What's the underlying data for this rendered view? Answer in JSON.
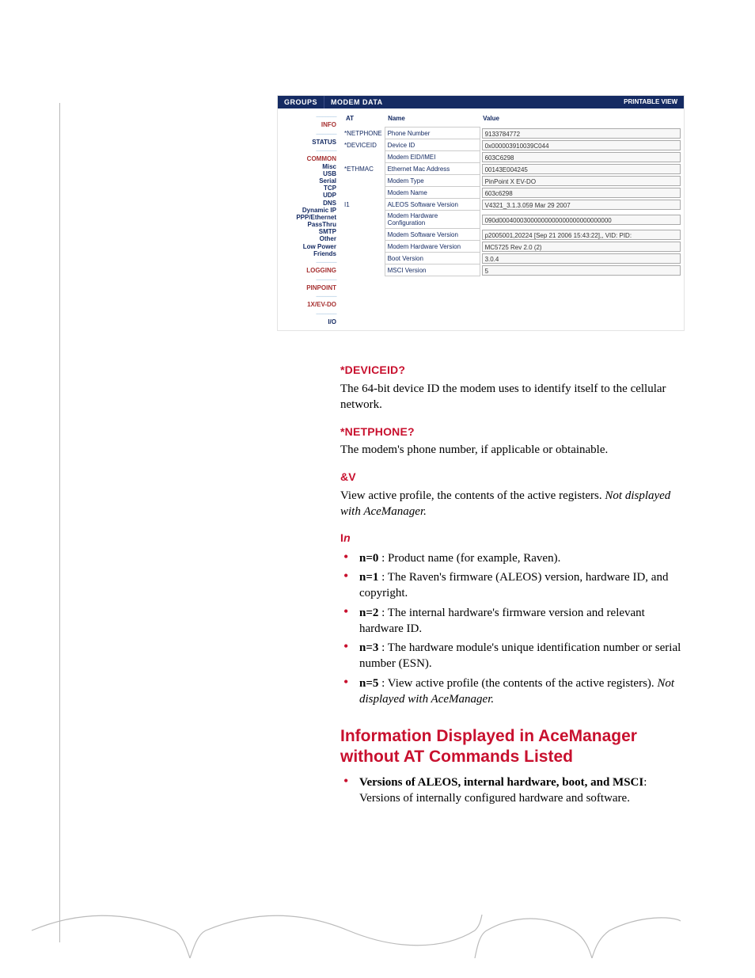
{
  "acemgr": {
    "header": {
      "groups": "GROUPS",
      "modem_data": "MODEM DATA",
      "printable": "PRINTABLE VIEW"
    },
    "groups": {
      "info": "INFO",
      "status": "STATUS",
      "common": "COMMON",
      "misc": "Misc",
      "usb": "USB",
      "serial": "Serial",
      "tcp": "TCP",
      "udp": "UDP",
      "dns": "DNS",
      "dynamic_ip": "Dynamic IP",
      "ppp_ethernet": "PPP/Ethernet",
      "passthru": "PassThru",
      "smtp": "SMTP",
      "other": "Other",
      "low_power": "Low Power",
      "friends": "Friends",
      "logging": "LOGGING",
      "pinpoint": "PINPOINT",
      "onex_evdo": "1X/EV-DO",
      "io": "I/O"
    },
    "table": {
      "headers": {
        "at": "AT",
        "name": "Name",
        "value": "Value"
      },
      "rows": [
        {
          "at": "*NETPHONE",
          "name": "Phone Number",
          "value": "9133784772"
        },
        {
          "at": "*DEVICEID",
          "name": "Device ID",
          "value": "0x000003910039C044"
        },
        {
          "at": "",
          "name": "Modem EID/IMEI",
          "value": "603C6298"
        },
        {
          "at": "*ETHMAC",
          "name": "Ethernet Mac Address",
          "value": "00143E004245"
        },
        {
          "at": "",
          "name": "Modem Type",
          "value": "PinPoint X EV-DO"
        },
        {
          "at": "",
          "name": "Modem Name",
          "value": "603c6298"
        },
        {
          "at": "I1",
          "name": "ALEOS Software Version",
          "value": "V4321_3.1.3.059 Mar 29 2007"
        },
        {
          "at": "",
          "name": "Modem Hardware Configuration",
          "value": "090d00040003000000000000000000000000"
        },
        {
          "at": "",
          "name": "Modem Software Version",
          "value": "p2005001,20224 [Sep 21 2006 15:43:22],, VID: PID:"
        },
        {
          "at": "",
          "name": "Modem Hardware Version",
          "value": "MC5725 Rev 2.0 (2)"
        },
        {
          "at": "",
          "name": "Boot Version",
          "value": "3.0.4"
        },
        {
          "at": "",
          "name": "MSCI Version",
          "value": "5"
        }
      ]
    }
  },
  "doc": {
    "deviceid_head": "*DEVICEID?",
    "deviceid_body": "The 64-bit device ID the modem uses to identify itself to the cellular network.",
    "netphone_head": "*NETPHONE?",
    "netphone_body": "The modem's phone number, if applicable or obtainable.",
    "ampv_head": "&V",
    "ampv_body_pre": "View active profile, the contents of the active registers. ",
    "ampv_body_ital": "Not displayed with AceManager.",
    "in_head_pre": "I",
    "in_head_ital": "n",
    "in_items": [
      {
        "b": "n=0",
        "rest": " : Product name (for example, Raven)."
      },
      {
        "b": "n=1",
        "rest": " : The Raven's firmware (ALEOS) version, hardware ID, and copyright."
      },
      {
        "b": "n=2",
        "rest": " : The internal hardware's firmware version and relevant hardware ID."
      },
      {
        "b": "n=3",
        "rest": " : The hardware module's unique identification number or serial number (ESN)."
      },
      {
        "b": "n=5",
        "rest_pre": " : View active profile (the contents of the active registers). ",
        "rest_ital": "Not displayed with AceManager."
      }
    ],
    "section_heading": "Information Displayed in AceManager without AT Commands Listed",
    "versions_b": "Versions of ALEOS, internal hardware, boot, and MSCI",
    "versions_rest": ": Versions of internally configured hardware and software."
  }
}
